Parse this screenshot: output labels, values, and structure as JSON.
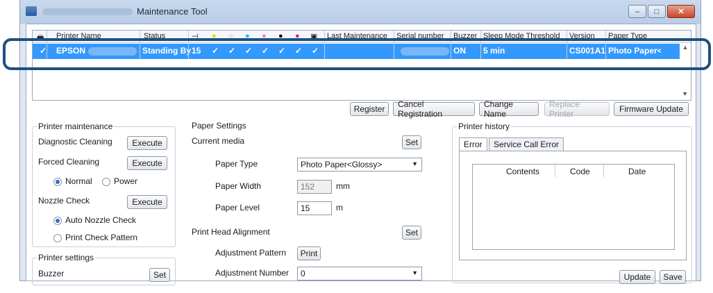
{
  "window": {
    "title": "Maintenance Tool",
    "controls": [
      "–",
      "□",
      "✕"
    ]
  },
  "grid": {
    "headers": [
      {
        "name": "col-printer-icon",
        "label": "🖶"
      },
      {
        "name": "col-printer-name",
        "label": "Printer Name"
      },
      {
        "name": "col-status",
        "label": "Status"
      },
      {
        "name": "col-paper-icon",
        "label": "⊣"
      },
      {
        "name": "col-ink-yellow",
        "label": "●"
      },
      {
        "name": "col-ink-light",
        "label": "○"
      },
      {
        "name": "col-ink-cyan",
        "label": "●"
      },
      {
        "name": "col-ink-lightmagenta",
        "label": "●"
      },
      {
        "name": "col-ink-black",
        "label": "●"
      },
      {
        "name": "col-ink-magenta",
        "label": "●"
      },
      {
        "name": "col-waste",
        "label": "▣"
      },
      {
        "name": "col-last-maintenance",
        "label": "Last Maintenance"
      },
      {
        "name": "col-serial-number",
        "label": "Serial number"
      },
      {
        "name": "col-buzzer",
        "label": "Buzzer"
      },
      {
        "name": "col-sleep",
        "label": "Sleep Mode Threshold"
      },
      {
        "name": "col-version",
        "label": "Version"
      },
      {
        "name": "col-paper-type",
        "label": "Paper Type"
      }
    ],
    "ink_colors": [
      "#f2d200",
      "#ffffff",
      "#22c1e0",
      "#f07fd0",
      "#111111",
      "#d6208c"
    ],
    "row": {
      "check": "✓",
      "printer_name": "EPSON",
      "status": "Standing By",
      "paper_count": "15",
      "ink_checks": [
        "✓",
        "✓",
        "✓",
        "✓",
        "✓",
        "✓",
        "✓"
      ],
      "last_maintenance": "",
      "serial_number": "",
      "buzzer": "ON",
      "sleep": "5 min",
      "version": "CS001A1",
      "paper_type": "Photo Paper<"
    }
  },
  "buttons": {
    "register": "Register",
    "cancel_registration": "Cancel Registration",
    "change_name": "Change Name",
    "replace_printer": "Replace Printer",
    "firmware_update": "Firmware Update"
  },
  "printer_maintenance": {
    "title": "Printer maintenance",
    "diagnostic_cleaning": "Diagnostic Cleaning",
    "forced_cleaning": "Forced Cleaning",
    "execute": "Execute",
    "normal": "Normal",
    "power": "Power",
    "nozzle_check": "Nozzle Check",
    "auto_nozzle_check": "Auto Nozzle Check",
    "print_check_pattern": "Print Check Pattern"
  },
  "printer_settings": {
    "title": "Printer settings",
    "buzzer": "Buzzer",
    "set": "Set"
  },
  "paper_settings": {
    "title": "Paper Settings",
    "current_media": "Current media",
    "set": "Set",
    "paper_type_label": "Paper Type",
    "paper_type_value": "Photo Paper<Glossy>",
    "paper_width_label": "Paper Width",
    "paper_width_value": "152",
    "paper_width_unit": "mm",
    "paper_level_label": "Paper Level",
    "paper_level_value": "15",
    "paper_level_unit": "m",
    "print_head_alignment": "Print Head Alignment",
    "adjustment_pattern": "Adjustment Pattern",
    "print": "Print",
    "adjustment_number": "Adjustment Number",
    "adjustment_number_value": "0"
  },
  "printer_history": {
    "title": "Printer history",
    "tab_error": "Error",
    "tab_service_call_error": "Service Call Error",
    "col_contents": "Contents",
    "col_code": "Code",
    "col_date": "Date",
    "update": "Update",
    "save": "Save"
  }
}
